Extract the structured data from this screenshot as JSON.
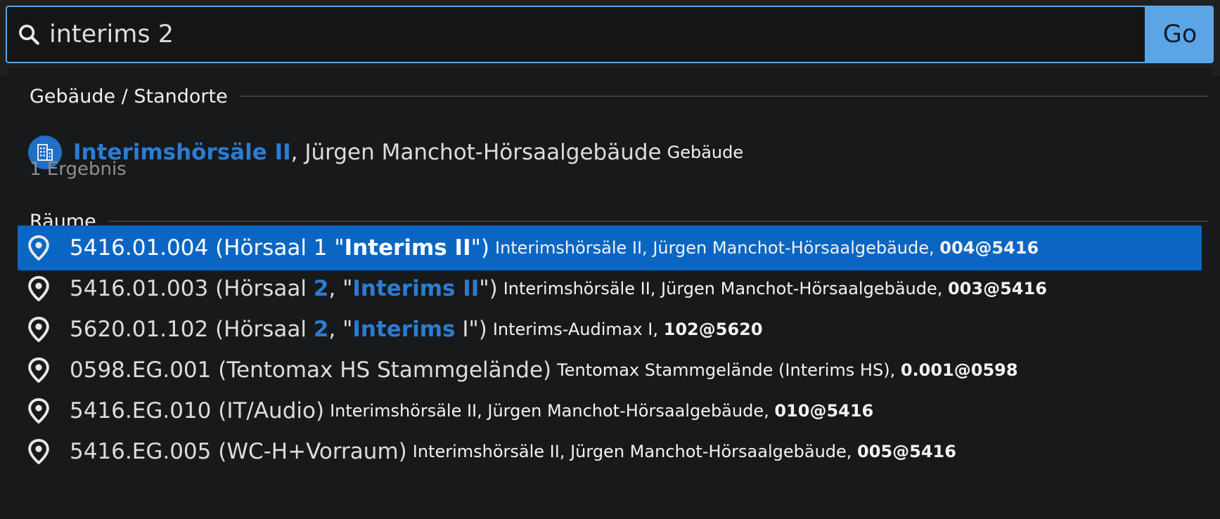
{
  "search": {
    "value": "interims 2",
    "go_label": "Go"
  },
  "sections": {
    "buildings": {
      "header": "Gebäude / Standorte",
      "result": {
        "highlight": "Interimshörsäle II",
        "rest": ", Jürgen Manchot-Hörsaalgebäude",
        "type": "Gebäude"
      },
      "count": "1 Ergebnis"
    },
    "rooms": {
      "header": "Räume",
      "items": [
        {
          "t1": "5416.01.004 (Hörsaal 1 \"",
          "h1": "Interims II",
          "t2": "\")",
          "h2": "",
          "t3": "",
          "loc": "Interimshörsäle II, Jürgen Manchot-Hörsaalgebäude, ",
          "code": "004@5416"
        },
        {
          "t1": "5416.01.003 (Hörsaal ",
          "h1": "2",
          "t2": ", \"",
          "h2": "Interims II",
          "t3": "\")",
          "loc": "Interimshörsäle II, Jürgen Manchot-Hörsaalgebäude, ",
          "code": "003@5416"
        },
        {
          "t1": "5620.01.102 (Hörsaal ",
          "h1": "2",
          "t2": ", \"",
          "h2": "Interims",
          "t3": " I\")",
          "loc": "Interims-Audimax I, ",
          "code": "102@5620"
        },
        {
          "t1": "0598.EG.001 (Tentomax HS Stammgelände)",
          "h1": "",
          "t2": "",
          "h2": "",
          "t3": "",
          "loc": "Tentomax Stammgelände (Interims HS), ",
          "code": "0.001@0598"
        },
        {
          "t1": "5416.EG.010 (IT/Audio)",
          "h1": "",
          "t2": "",
          "h2": "",
          "t3": "",
          "loc": "Interimshörsäle II, Jürgen Manchot-Hörsaalgebäude, ",
          "code": "010@5416"
        },
        {
          "t1": "5416.EG.005 (WC-H+Vorraum)",
          "h1": "",
          "t2": "",
          "h2": "",
          "t3": "",
          "loc": "Interimshörsäle II, Jürgen Manchot-Hörsaalgebäude, ",
          "code": "005@5416"
        }
      ]
    }
  },
  "colors": {
    "accent": "#5ba5e6",
    "highlight": "#2c7cd2",
    "selected_row": "#0b66c3"
  },
  "icons": {
    "search": "search-icon",
    "building": "building-icon",
    "room": "location-pin-icon"
  }
}
